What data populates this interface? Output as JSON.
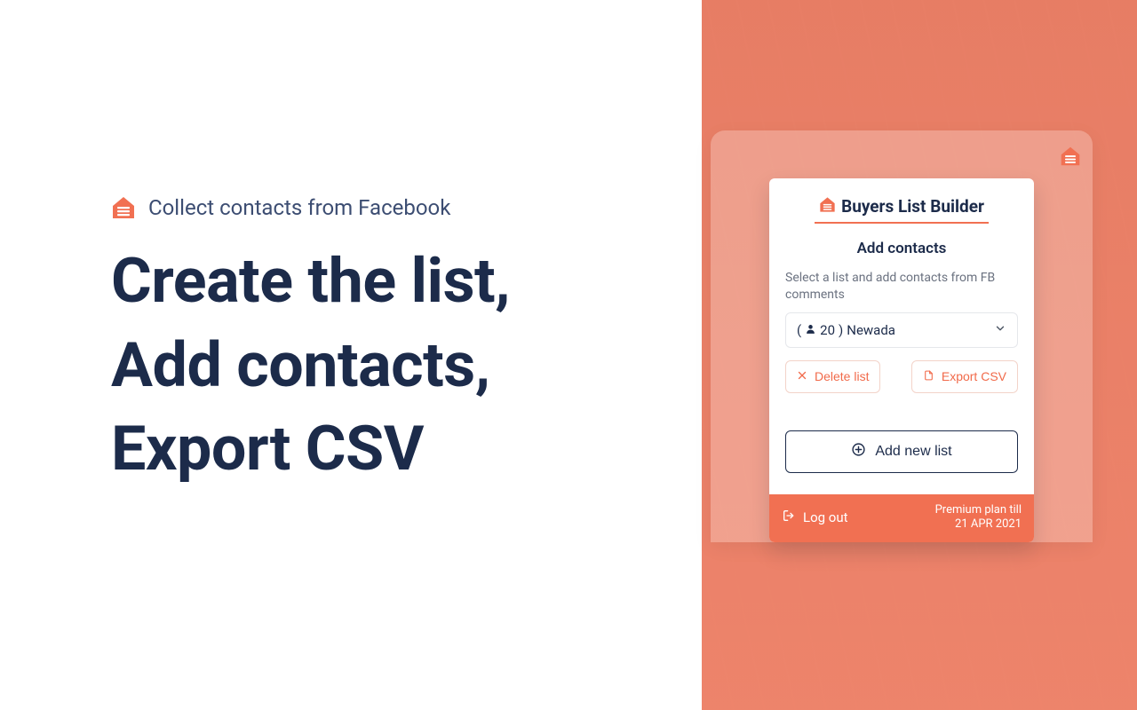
{
  "colors": {
    "accent": "#f17052",
    "navy": "#1c2b4a",
    "muted": "#6b7280",
    "ghostBorder": "#f3d3c9"
  },
  "hero": {
    "tagline": "Collect contacts from Facebook",
    "headline_line1": "Create the list,",
    "headline_line2": "Add contacts,",
    "headline_line3": "Export CSV"
  },
  "popup": {
    "brand": "Buyers List Builder",
    "section_title": "Add contacts",
    "help": "Select a list and add contacts from FB comments",
    "select": {
      "prefix_open": "( ",
      "count": "20",
      "prefix_close": ") ",
      "name": "Newada"
    },
    "delete_label": "Delete list",
    "export_label": "Export CSV",
    "add_label": "Add new list",
    "logout_label": "Log out",
    "plan_line1": "Premium plan till",
    "plan_line2": "21 APR 2021"
  }
}
